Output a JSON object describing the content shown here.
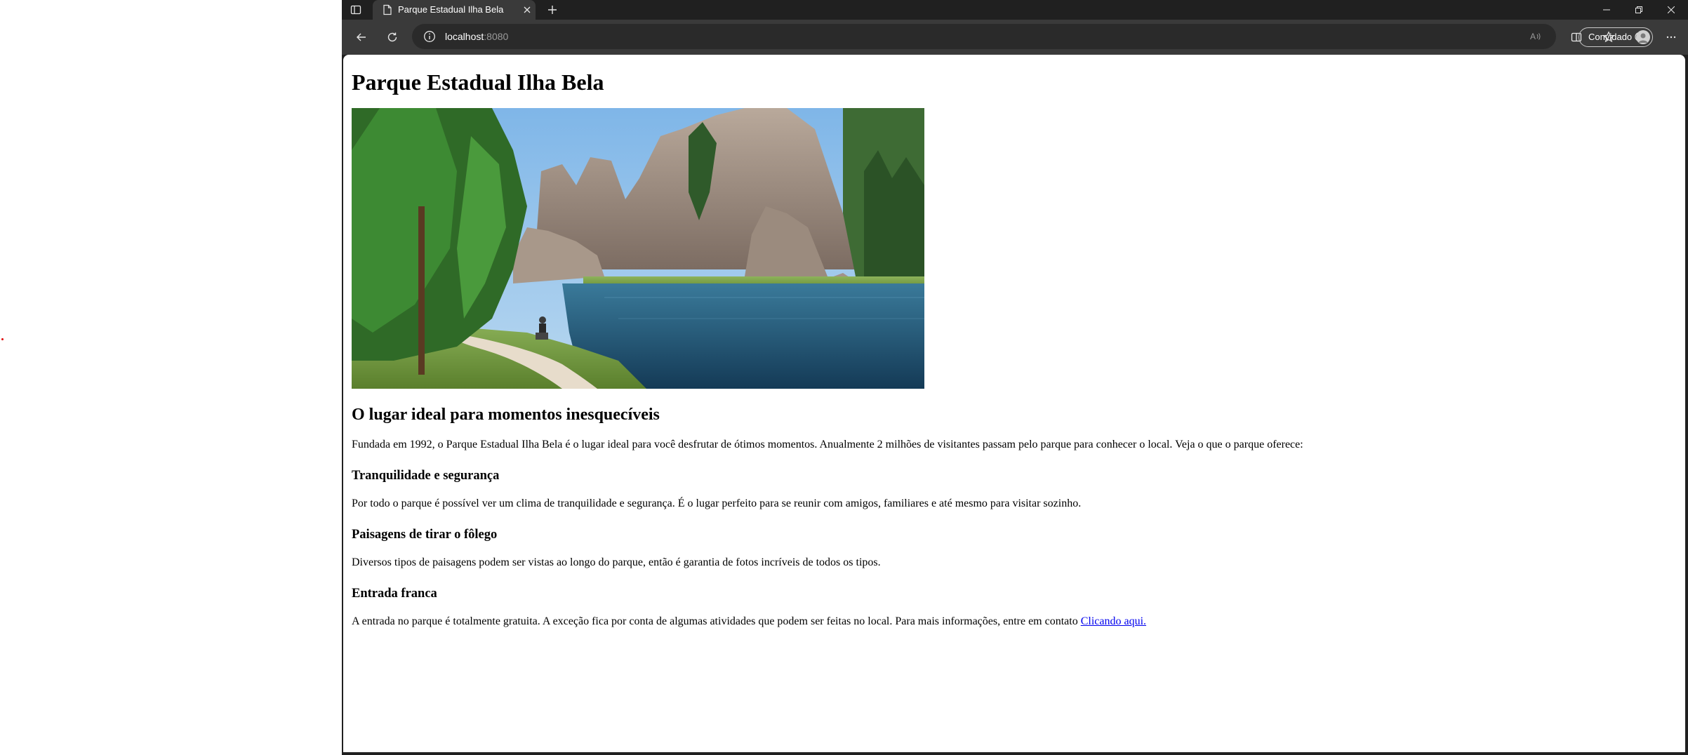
{
  "browser": {
    "tab_title": "Parque Estadual Ilha Bela",
    "address_host": "localhost",
    "address_port": ":8080",
    "profile_label": "Convidado",
    "icons": [
      "tab-actions-icon",
      "page-icon",
      "close-icon",
      "plus-icon",
      "minimize-icon",
      "restore-icon",
      "close-window-icon",
      "back-icon",
      "refresh-icon",
      "info-icon",
      "read-aloud-icon",
      "split-screen-icon",
      "favorites-icon",
      "copilot-icon",
      "more-icon"
    ]
  },
  "page": {
    "title": "Parque Estadual Ilha Bela",
    "hero_alt": "Lago cercado por rochas e pinheiros",
    "section_title": "O lugar ideal para momentos inesquecíveis",
    "intro": "Fundada em 1992, o Parque Estadual Ilha Bela é o lugar ideal para você desfrutar de ótimos momentos. Anualmente 2 milhões de visitantes passam pelo parque para conhecer o local. Veja o que o parque oferece:",
    "features": [
      {
        "title": "Tranquilidade e segurança",
        "text": "Por todo o parque é possível ver um clima de tranquilidade e segurança. É o lugar perfeito para se reunir com amigos, familiares e até mesmo para visitar sozinho."
      },
      {
        "title": "Paisagens de tirar o fôlego",
        "text": "Diversos tipos de paisagens podem ser vistas ao longo do parque, então é garantia de fotos incríveis de todos os tipos."
      },
      {
        "title": "Entrada franca",
        "text": "A entrada no parque é totalmente gratuita. A exceção fica por conta de algumas atividades que podem ser feitas no local. Para mais informações, entre em contato "
      }
    ],
    "contact_link": "Clicando aqui."
  }
}
